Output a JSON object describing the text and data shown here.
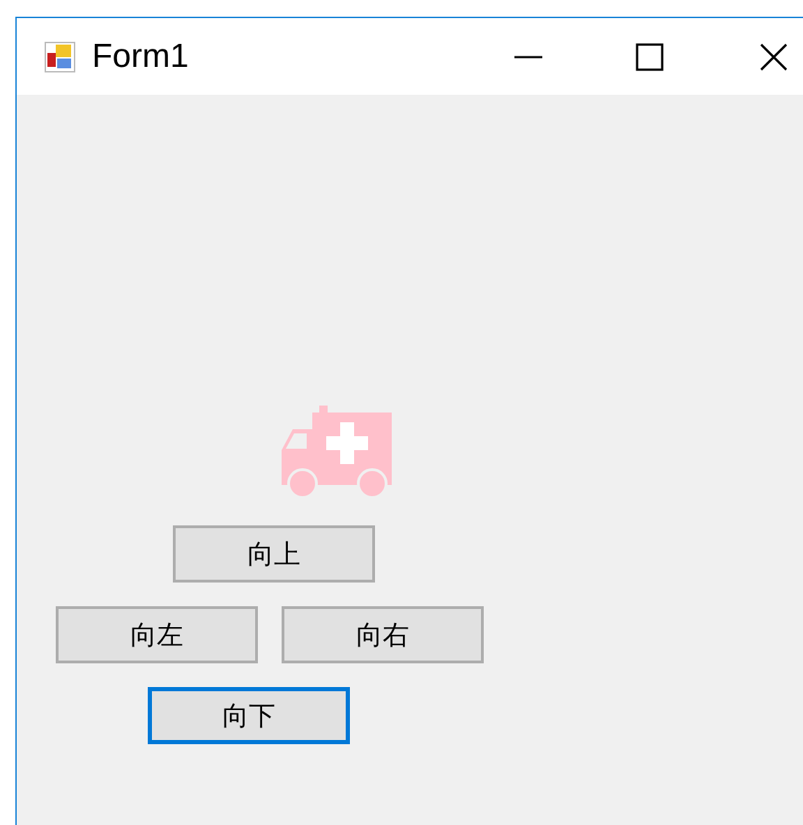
{
  "window": {
    "title": "Form1"
  },
  "buttons": [
    {
      "label": "向上",
      "focused": false
    },
    {
      "label": "向左",
      "focused": false
    },
    {
      "label": "向右",
      "focused": false
    },
    {
      "label": "向下",
      "focused": true
    }
  ]
}
